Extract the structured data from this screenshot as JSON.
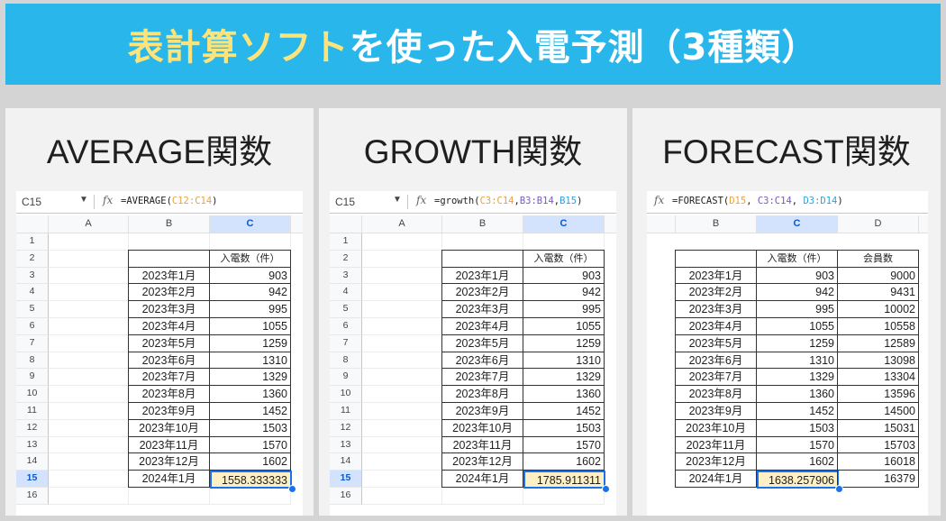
{
  "header": {
    "title_highlight": "表計算ソフト",
    "title_rest": "を使った入電予測（3種類）"
  },
  "panels": [
    {
      "title": "AVERAGE関数",
      "name_box": "C15",
      "formula_parts": [
        {
          "text": "=AVERAGE(",
          "cls": ""
        },
        {
          "text": "C12:C14",
          "cls": "ref1"
        },
        {
          "text": ")",
          "cls": ""
        }
      ],
      "columns": [
        "A",
        "B",
        "C"
      ],
      "active_column": "C",
      "rows": [
        "1",
        "2",
        "3",
        "4",
        "5",
        "6",
        "7",
        "8",
        "9",
        "10",
        "11",
        "12",
        "13",
        "14",
        "15",
        "16"
      ],
      "active_row": "15",
      "table_header": [
        "",
        "入電数（件）"
      ],
      "table_rows": [
        [
          "2023年1月",
          "903"
        ],
        [
          "2023年2月",
          "942"
        ],
        [
          "2023年3月",
          "995"
        ],
        [
          "2023年4月",
          "1055"
        ],
        [
          "2023年5月",
          "1259"
        ],
        [
          "2023年6月",
          "1310"
        ],
        [
          "2023年7月",
          "1329"
        ],
        [
          "2023年8月",
          "1360"
        ],
        [
          "2023年9月",
          "1452"
        ],
        [
          "2023年10月",
          "1503"
        ],
        [
          "2023年11月",
          "1570"
        ],
        [
          "2023年12月",
          "1602"
        ]
      ],
      "result_row": [
        "2024年1月",
        "1558.333333"
      ]
    },
    {
      "title": "GROWTH関数",
      "name_box": "C15",
      "formula_parts": [
        {
          "text": "=growth(",
          "cls": ""
        },
        {
          "text": "C3:C14",
          "cls": "ref1"
        },
        {
          "text": ",",
          "cls": ""
        },
        {
          "text": "B3:B14",
          "cls": "ref2"
        },
        {
          "text": ",",
          "cls": ""
        },
        {
          "text": "B15",
          "cls": "ref3"
        },
        {
          "text": ")",
          "cls": ""
        }
      ],
      "columns": [
        "A",
        "B",
        "C"
      ],
      "active_column": "C",
      "rows": [
        "1",
        "2",
        "3",
        "4",
        "5",
        "6",
        "7",
        "8",
        "9",
        "10",
        "11",
        "12",
        "13",
        "14",
        "15",
        "16"
      ],
      "active_row": "15",
      "table_header": [
        "",
        "入電数（件）"
      ],
      "table_rows": [
        [
          "2023年1月",
          "903"
        ],
        [
          "2023年2月",
          "942"
        ],
        [
          "2023年3月",
          "995"
        ],
        [
          "2023年4月",
          "1055"
        ],
        [
          "2023年5月",
          "1259"
        ],
        [
          "2023年6月",
          "1310"
        ],
        [
          "2023年7月",
          "1329"
        ],
        [
          "2023年8月",
          "1360"
        ],
        [
          "2023年9月",
          "1452"
        ],
        [
          "2023年10月",
          "1503"
        ],
        [
          "2023年11月",
          "1570"
        ],
        [
          "2023年12月",
          "1602"
        ]
      ],
      "result_row": [
        "2024年1月",
        "1785.911311"
      ]
    },
    {
      "title": "FORECAST関数",
      "formula_parts": [
        {
          "text": "=FORECAST(",
          "cls": ""
        },
        {
          "text": "D15",
          "cls": "ref1"
        },
        {
          "text": ", ",
          "cls": ""
        },
        {
          "text": "C3:C14",
          "cls": "ref2"
        },
        {
          "text": ", ",
          "cls": ""
        },
        {
          "text": "D3:D14",
          "cls": "ref3"
        },
        {
          "text": ")",
          "cls": ""
        }
      ],
      "columns": [
        "B",
        "C",
        "D"
      ],
      "active_column": "C",
      "table_header": [
        "",
        "入電数（件）",
        "会員数"
      ],
      "table_rows": [
        [
          "2023年1月",
          "903",
          "9000"
        ],
        [
          "2023年2月",
          "942",
          "9431"
        ],
        [
          "2023年3月",
          "995",
          "10002"
        ],
        [
          "2023年4月",
          "1055",
          "10558"
        ],
        [
          "2023年5月",
          "1259",
          "12589"
        ],
        [
          "2023年6月",
          "1310",
          "13098"
        ],
        [
          "2023年7月",
          "1329",
          "13304"
        ],
        [
          "2023年8月",
          "1360",
          "13596"
        ],
        [
          "2023年9月",
          "1452",
          "14500"
        ],
        [
          "2023年10月",
          "1503",
          "15031"
        ],
        [
          "2023年11月",
          "1570",
          "15703"
        ],
        [
          "2023年12月",
          "1602",
          "16018"
        ]
      ],
      "result_row": [
        "2024年1月",
        "1638.257906",
        "16379"
      ]
    }
  ],
  "icons": {
    "dropdown": "dropdown-arrow-icon",
    "function": "fx-icon"
  },
  "colors": {
    "banner": "#29b6ea",
    "title_highlight": "#fde47a",
    "selection": "#1a73e8",
    "result_fill": "#fef0c4"
  }
}
